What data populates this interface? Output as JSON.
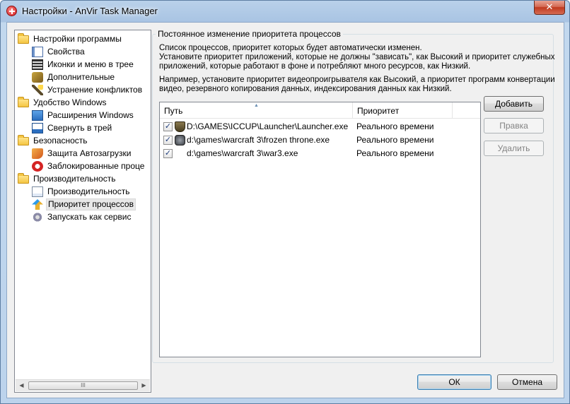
{
  "window": {
    "title": "Настройки - AnVir Task Manager",
    "close_label": "✕"
  },
  "tree": {
    "items": [
      {
        "label": "Настройки программы",
        "icon": "folder-icon",
        "level": 0
      },
      {
        "label": "Свойства",
        "icon": "properties-icon",
        "level": 1
      },
      {
        "label": "Иконки и меню в трее",
        "icon": "film-icon",
        "level": 1
      },
      {
        "label": "Дополнительные",
        "icon": "puzzle-icon",
        "level": 1
      },
      {
        "label": "Устранение конфликтов",
        "icon": "wand-icon",
        "level": 1
      },
      {
        "label": "Удобство Windows",
        "icon": "folder-icon",
        "level": 0
      },
      {
        "label": "Расширения Windows",
        "icon": "windows-ext-icon",
        "level": 1
      },
      {
        "label": "Свернуть в трей",
        "icon": "minimize-tray-icon",
        "level": 1
      },
      {
        "label": "Безопасность",
        "icon": "folder-icon",
        "level": 0
      },
      {
        "label": "Защита Автозагрузки",
        "icon": "shield-autorun-icon",
        "level": 1
      },
      {
        "label": "Заблокированные проце",
        "icon": "blocked-process-icon",
        "level": 1
      },
      {
        "label": "Производительность",
        "icon": "folder-icon",
        "level": 0
      },
      {
        "label": "Производительность",
        "icon": "performance-chart-icon",
        "level": 1
      },
      {
        "label": "Приоритет процессов",
        "icon": "priority-icon",
        "level": 1,
        "selected": true
      },
      {
        "label": "Запускать как сервис",
        "icon": "gears-icon",
        "level": 1
      }
    ]
  },
  "group": {
    "legend": "Постоянное изменение приоритета процессов",
    "desc1": [
      "Список процессов, приоритет которых будет автоматически изменен.",
      "Установите приоритет приложений, которые не должны \"зависать\", как Высокий и приоритет служебных",
      "приложений, которые работают в фоне и потребляют много ресурсов, как Низкий."
    ],
    "desc2": [
      "Например, установите приоритет видеопроигрывателя как Высокий, а приоритет программ конвертации",
      "видео, резервного копирования данных, индексирования данных как Низкий."
    ]
  },
  "list": {
    "columns": {
      "path": "Путь",
      "priority": "Приоритет"
    },
    "rows": [
      {
        "checked": true,
        "icon": "iccup-launcher-icon",
        "path": "D:\\GAMES\\ICCUP\\Launcher\\Launcher.exe",
        "priority": "Реального времени"
      },
      {
        "checked": true,
        "icon": "warcraft-frozen-throne-icon",
        "path": "d:\\games\\warcraft 3\\frozen throne.exe",
        "priority": "Реального времени"
      },
      {
        "checked": true,
        "icon": "",
        "path": "d:\\games\\warcraft 3\\war3.exe",
        "priority": "Реального времени"
      }
    ],
    "check_mark": "✓"
  },
  "buttons": {
    "add": "Добавить",
    "edit": "Правка",
    "delete": "Удалить",
    "ok": "ОК",
    "cancel": "Отмена"
  },
  "scrollbar": {
    "left_arrow": "◀",
    "right_arrow": "▶",
    "grip": "III"
  }
}
